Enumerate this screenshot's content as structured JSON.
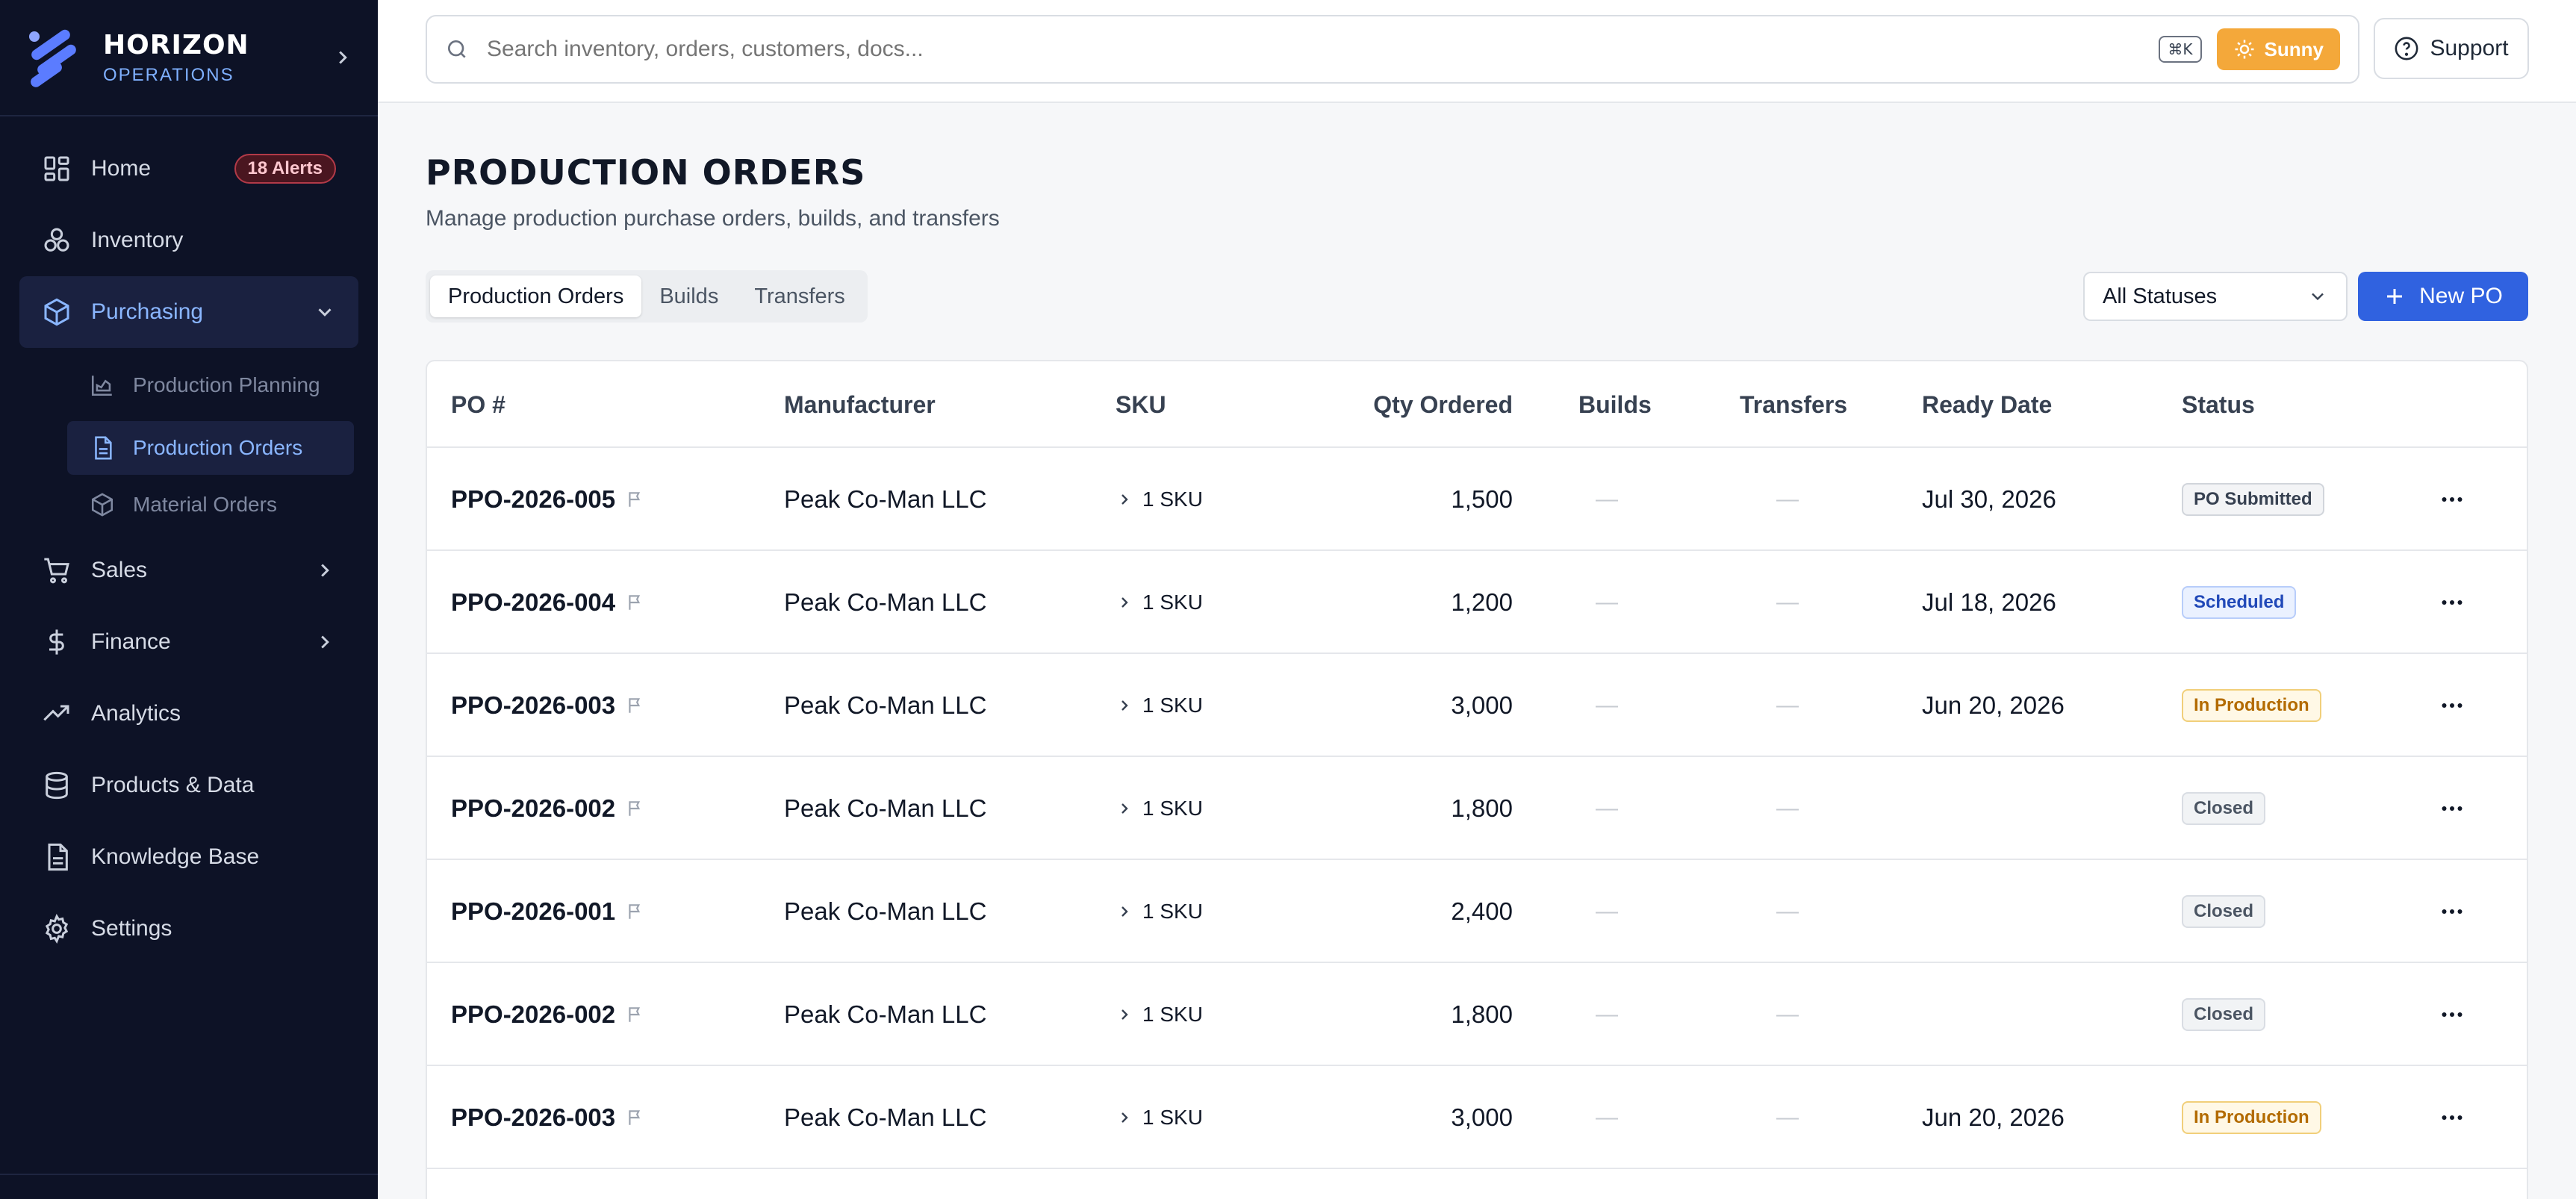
{
  "brand": {
    "name": "HORIZON",
    "sub": "OPERATIONS"
  },
  "colors": {
    "sidebar_bg": "#0d1226",
    "accent": "#3062e0",
    "active_text": "#8ab6ff",
    "alert": "#b23a48",
    "weather": "#f4a83a"
  },
  "nav": {
    "home": {
      "label": "Home",
      "icon": "grid-icon",
      "badge": "18 Alerts"
    },
    "inventory": {
      "label": "Inventory",
      "icon": "boxes-icon"
    },
    "purchasing": {
      "label": "Purchasing",
      "icon": "package-icon"
    },
    "production_planning": {
      "label": "Production Planning",
      "icon": "chart-icon"
    },
    "production_orders": {
      "label": "Production Orders",
      "icon": "document-icon"
    },
    "material_orders": {
      "label": "Material Orders",
      "icon": "package-icon"
    },
    "sales": {
      "label": "Sales",
      "icon": "cart-icon"
    },
    "finance": {
      "label": "Finance",
      "icon": "dollar-icon"
    },
    "analytics": {
      "label": "Analytics",
      "icon": "trend-icon"
    },
    "products_data": {
      "label": "Products & Data",
      "icon": "database-icon"
    },
    "knowledge_base": {
      "label": "Knowledge Base",
      "icon": "document-icon"
    },
    "settings": {
      "label": "Settings",
      "icon": "gear-icon"
    }
  },
  "topbar": {
    "search_placeholder": "Search inventory, orders, customers, docs...",
    "shortcut": "⌘K",
    "weather": "Sunny",
    "support": "Support"
  },
  "page": {
    "title": "PRODUCTION ORDERS",
    "subtitle": "Manage production purchase orders, builds, and transfers",
    "tabs": [
      "Production Orders",
      "Builds",
      "Transfers"
    ],
    "status_filter": "All Statuses",
    "new_button": "New PO"
  },
  "table": {
    "columns": [
      "PO #",
      "Manufacturer",
      "SKU",
      "Qty Ordered",
      "Builds",
      "Transfers",
      "Ready Date",
      "Status"
    ],
    "rows": [
      {
        "po": "PPO-2026-005",
        "manufacturer": "Peak Co-Man LLC",
        "sku": "1 SKU",
        "qty": "1,500",
        "builds": "—",
        "transfers": "—",
        "ready": "Jul 30, 2026",
        "status": "PO Submitted"
      },
      {
        "po": "PPO-2026-004",
        "manufacturer": "Peak Co-Man LLC",
        "sku": "1 SKU",
        "qty": "1,200",
        "builds": "—",
        "transfers": "—",
        "ready": "Jul 18, 2026",
        "status": "Scheduled"
      },
      {
        "po": "PPO-2026-003",
        "manufacturer": "Peak Co-Man LLC",
        "sku": "1 SKU",
        "qty": "3,000",
        "builds": "—",
        "transfers": "—",
        "ready": "Jun 20, 2026",
        "status": "In Production"
      },
      {
        "po": "PPO-2026-002",
        "manufacturer": "Peak Co-Man LLC",
        "sku": "1 SKU",
        "qty": "1,800",
        "builds": "—",
        "transfers": "—",
        "ready": "",
        "status": "Closed"
      },
      {
        "po": "PPO-2026-001",
        "manufacturer": "Peak Co-Man LLC",
        "sku": "1 SKU",
        "qty": "2,400",
        "builds": "—",
        "transfers": "—",
        "ready": "",
        "status": "Closed"
      },
      {
        "po": "PPO-2026-002",
        "manufacturer": "Peak Co-Man LLC",
        "sku": "1 SKU",
        "qty": "1,800",
        "builds": "—",
        "transfers": "—",
        "ready": "",
        "status": "Closed"
      },
      {
        "po": "PPO-2026-003",
        "manufacturer": "Peak Co-Man LLC",
        "sku": "1 SKU",
        "qty": "3,000",
        "builds": "—",
        "transfers": "—",
        "ready": "Jun 20, 2026",
        "status": "In Production"
      }
    ]
  }
}
